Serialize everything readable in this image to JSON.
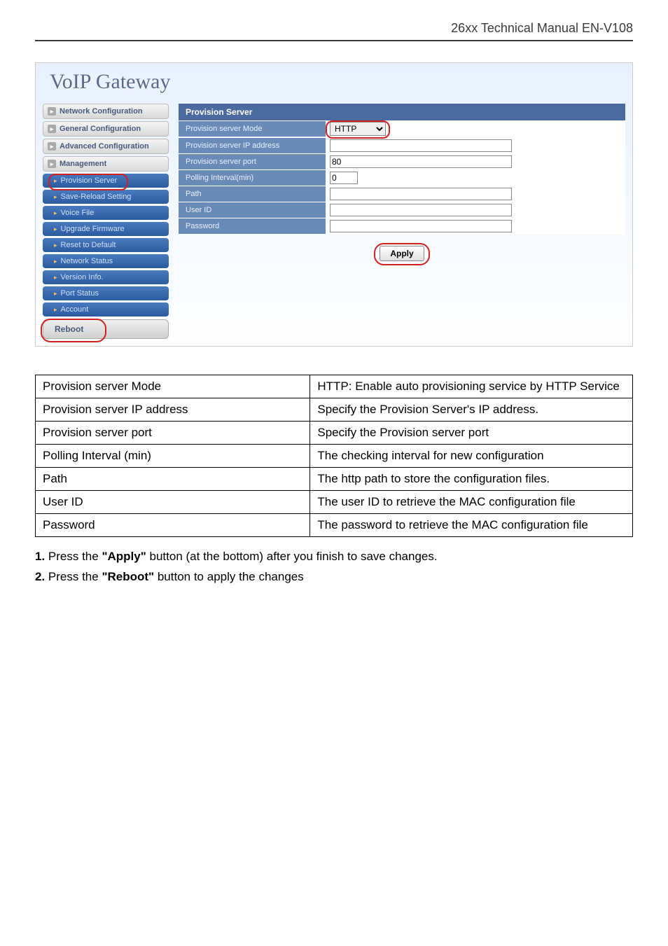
{
  "header": {
    "title": "26xx Technical Manual EN-V108"
  },
  "ui": {
    "logo": "VoIP  Gateway",
    "sidebar": {
      "groups": [
        "Network Configuration",
        "General Configuration",
        "Advanced Configuration",
        "Management"
      ],
      "items": [
        "Provision Server",
        "Save-Reload Setting",
        "Voice File",
        "Upgrade Firmware",
        "Reset to Default",
        "Network Status",
        "Version Info.",
        "Port Status",
        "Account"
      ],
      "reboot": "Reboot"
    },
    "panel": {
      "title": "Provision Server",
      "rows": {
        "mode_label": "Provision server Mode",
        "mode_value": "HTTP",
        "ip_label": "Provision server IP address",
        "ip_value": "",
        "port_label": "Provision server port",
        "port_value": "80",
        "poll_label": "Polling Interval(min)",
        "poll_value": "0",
        "path_label": "Path",
        "path_value": "",
        "user_label": "User ID",
        "user_value": "",
        "pass_label": "Password",
        "pass_value": ""
      },
      "apply": "Apply"
    }
  },
  "doc_table": [
    {
      "k": "Provision server Mode",
      "v": "HTTP: Enable auto provisioning service by HTTP Service"
    },
    {
      "k": "Provision server IP address",
      "v": "Specify the Provision Server's IP address."
    },
    {
      "k": "Provision server port",
      "v": "Specify the Provision server port"
    },
    {
      "k": "Polling Interval (min)",
      "v": "The checking interval for new configuration"
    },
    {
      "k": "Path",
      "v": "The http path to store the configuration files."
    },
    {
      "k": "User ID",
      "v": "The user ID to retrieve the MAC configuration file"
    },
    {
      "k": "Password",
      "v": "The password to retrieve the MAC configuration file"
    }
  ],
  "notes": {
    "n1a": "1.",
    "n1b": " Press the ",
    "n1c": "\"Apply\"",
    "n1d": " button (at the bottom) after you finish to save changes.",
    "n2a": "2.",
    "n2b": " Press the ",
    "n2c": "\"Reboot\"",
    "n2d": " button to apply the changes"
  }
}
